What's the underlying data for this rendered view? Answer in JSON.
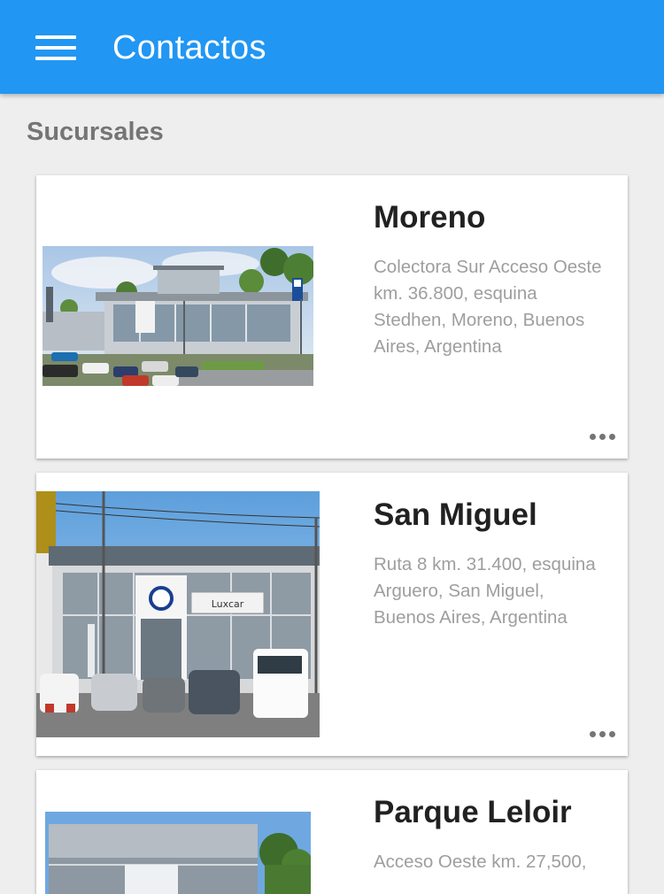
{
  "app_bar": {
    "title": "Contactos",
    "menu_icon": "hamburger-menu-icon",
    "color": "#2196f3"
  },
  "section": {
    "title": "Sucursales"
  },
  "branches": [
    {
      "name": "Moreno",
      "address": "Colectora Sur Acceso Oeste km. 36.800, esquina Stedhen, Moreno, Buenos Aires, Argentina",
      "more_icon": "more-horizontal-icon"
    },
    {
      "name": "San Miguel",
      "address": "Ruta 8 km. 31.400, esquina Arguero, San Miguel, Buenos Aires, Argentina",
      "photo_sign": "Luxcar",
      "more_icon": "more-horizontal-icon"
    },
    {
      "name": "Parque Leloir",
      "address": "Acceso Oeste km. 27,500,"
    }
  ]
}
